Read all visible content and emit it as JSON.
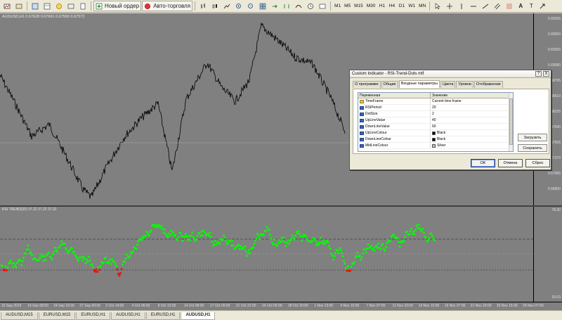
{
  "toolbar": {
    "new_order": "Новый ордер",
    "auto_trading": "Авто-торговля",
    "timeframes": [
      "M1",
      "M5",
      "M15",
      "M30",
      "H1",
      "H4",
      "D1",
      "W1",
      "MN"
    ]
  },
  "chart": {
    "title": "AUDUSD,H1  0.67628 0.67661 0.67590 0.67572",
    "background_color": "#808080",
    "price_color": "#000000",
    "price_labels": [
      "0.69935",
      "0.69650",
      "0.69365",
      "0.69080",
      "0.68795",
      "0.68510",
      "0.68225",
      "0.67940",
      "0.67655",
      "0.67370",
      "0.67085",
      "0.66800"
    ],
    "rsi_title": "RSI TREND(20) 37.22 37.22 37.22",
    "rsi_labels": [
      "78.30",
      "20.03"
    ],
    "time_labels": [
      "16 Sep 2019",
      "19 Sep 08:00",
      "24 Sep 16:00",
      "27 Sep 00:00",
      "2 Oct 14:00",
      "4 Oct 06:00",
      "9 Oct 15:00",
      "14 Oct 08:00",
      "17 Oct 00:00",
      "21 Oct 22:00",
      "24 Oct 05:00",
      "28 Oct 20:00",
      "1 Nov 13:00",
      "4 Nov 15:00",
      "7 Nov 07:00",
      "11 Nov 23:00",
      "14 Nov 15:00",
      "19 Nov 07:00",
      "21 Nov 23:00",
      "26 Nov 15:00",
      "29 Nov 07:00"
    ],
    "up_color": "#00ff00",
    "down_color": "#ff0000"
  },
  "tabs": [
    "AUDUSD,M15",
    "EURUSD,M15",
    "EURUSD,H1",
    "AUDUSD,H1",
    "EURUSD,H1",
    "AUDUSD,H1"
  ],
  "dialog": {
    "title": "Custom Indicator - RSI-Trend-Dots mtf",
    "help": "?",
    "close": "X",
    "tabs": [
      "О программе",
      "Общие",
      "Входные параметры",
      "Цвета",
      "Уровни",
      "Отображение"
    ],
    "col_variable": "Переменная",
    "col_value": "Значение",
    "params": [
      {
        "name": "TimeFrame",
        "value": "Current time frame",
        "type": "enum"
      },
      {
        "name": "RSIPeriod",
        "value": "20",
        "type": "int"
      },
      {
        "name": "DotSize",
        "value": "2",
        "type": "int"
      },
      {
        "name": "UpLineValue",
        "value": "40",
        "type": "int"
      },
      {
        "name": "DownLineValue",
        "value": "60",
        "type": "int"
      },
      {
        "name": "UpLineColour",
        "value": "Black",
        "type": "color",
        "color": "#000000"
      },
      {
        "name": "DownLineColour",
        "value": "Black",
        "type": "color",
        "color": "#000000"
      },
      {
        "name": "MidLineColour",
        "value": "Silver",
        "type": "color",
        "color": "#c0c0c0"
      }
    ],
    "load": "Загрузить",
    "save": "Сохранить",
    "ok": "OK",
    "cancel": "Отмена",
    "reset": "Сброс"
  }
}
